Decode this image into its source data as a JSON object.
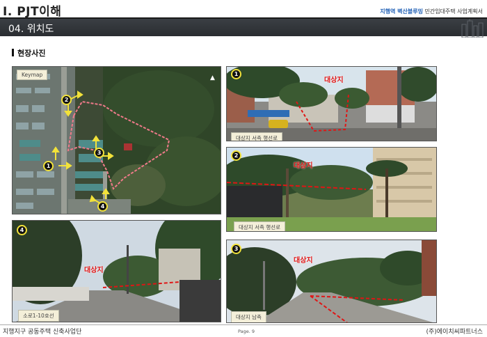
{
  "header": {
    "chapter_title": "Ⅰ. PJT이해",
    "project_highlight": "지행역 벽산블루밍",
    "project_rest": "민간임대주택 사업계획서"
  },
  "section": {
    "title": "04. 위치도"
  },
  "subsection": {
    "title": "현장사진"
  },
  "keymap": {
    "label": "Keymap",
    "markers": [
      "1",
      "2",
      "3",
      "4"
    ]
  },
  "photos": [
    {
      "number": "1",
      "target_label": "대상지",
      "caption": "대상지 서측 행선로"
    },
    {
      "number": "2",
      "target_label": "대상지",
      "caption": "대상지 서측 행선로"
    },
    {
      "number": "4",
      "target_label": "대상지",
      "caption": "소로1-10호선"
    },
    {
      "number": "3",
      "target_label": "대상지",
      "caption": "대상지 남측"
    }
  ],
  "footer": {
    "left": "지행지구 공동주택 신축사업단",
    "page": "Page. 9",
    "right": "(주)에이치씨파트너스"
  },
  "colors": {
    "header_bar": "#2f3236",
    "highlight": "#1f5fb5",
    "target_red": "#e01515",
    "marker_yellow": "#f2e23a"
  }
}
